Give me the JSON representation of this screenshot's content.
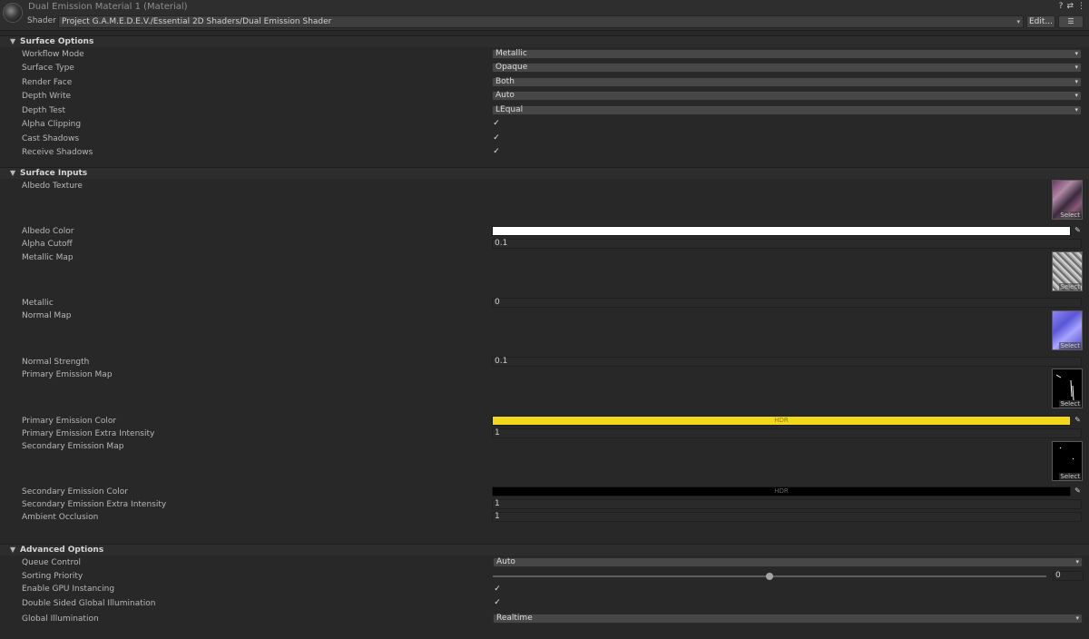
{
  "header": {
    "title": "Dual Emission Material 1 (Material)",
    "shader_label": "Shader",
    "shader_path": "Project G.A.M.E.D.E.V./Essential 2D Shaders/Dual Emission Shader",
    "edit_label": "Edit...",
    "list_label": "☰",
    "icons": [
      "help-icon",
      "preset-icon",
      "menu-icon"
    ]
  },
  "surface_options": {
    "title": "Surface Options",
    "workflow_mode": {
      "label": "Workflow Mode",
      "value": "Metallic"
    },
    "surface_type": {
      "label": "Surface Type",
      "value": "Opaque"
    },
    "render_face": {
      "label": "Render Face",
      "value": "Both"
    },
    "depth_write": {
      "label": "Depth Write",
      "value": "Auto"
    },
    "depth_test": {
      "label": "Depth Test",
      "value": "LEqual"
    },
    "alpha_clipping": {
      "label": "Alpha Clipping",
      "checked": true
    },
    "cast_shadows": {
      "label": "Cast Shadows",
      "checked": true
    },
    "receive_shadows": {
      "label": "Receive Shadows",
      "checked": true
    }
  },
  "surface_inputs": {
    "title": "Surface Inputs",
    "albedo_texture": {
      "label": "Albedo Texture",
      "select": "Select"
    },
    "albedo_color": {
      "label": "Albedo Color",
      "color": "#ffffff"
    },
    "alpha_cutoff": {
      "label": "Alpha Cutoff",
      "value": "0.1"
    },
    "metallic_map": {
      "label": "Metallic Map",
      "select": "Select"
    },
    "metallic": {
      "label": "Metallic",
      "value": "0"
    },
    "normal_map": {
      "label": "Normal Map",
      "select": "Select"
    },
    "normal_strength": {
      "label": "Normal Strength",
      "value": "0.1"
    },
    "primary_emission_map": {
      "label": "Primary Emission Map",
      "select": "Select"
    },
    "primary_emission_color": {
      "label": "Primary Emission Color",
      "color": "#f2d81c",
      "hdr": "HDR"
    },
    "primary_emission_extra": {
      "label": "Primary Emission Extra Intensity",
      "value": "1"
    },
    "secondary_emission_map": {
      "label": "Secondary Emission Map",
      "select": "Select"
    },
    "secondary_emission_color": {
      "label": "Secondary Emission Color",
      "color": "#000000",
      "hdr": "HDR"
    },
    "secondary_emission_extra": {
      "label": "Secondary Emission Extra Intensity",
      "value": "1"
    },
    "ambient_occlusion": {
      "label": "Ambient Occlusion",
      "value": "1"
    }
  },
  "advanced_options": {
    "title": "Advanced Options",
    "queue_control": {
      "label": "Queue Control",
      "value": "Auto"
    },
    "sorting_priority": {
      "label": "Sorting Priority",
      "value": "0",
      "level": 0.5
    },
    "gpu_instancing": {
      "label": "Enable GPU Instancing",
      "checked": true
    },
    "double_sided_gi": {
      "label": "Double Sided Global Illumination",
      "checked": true
    },
    "global_illumination": {
      "label": "Global Illumination",
      "value": "Realtime"
    }
  },
  "glyphs": {
    "check": "✓",
    "arrow": "▾",
    "triangle": "▼",
    "picker": "✎"
  }
}
